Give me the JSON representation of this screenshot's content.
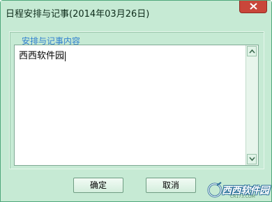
{
  "window": {
    "title": "日程安排与记事(2014年03月26日)"
  },
  "group": {
    "label": "安排与记事内容"
  },
  "memo": {
    "text": "西西软件园"
  },
  "buttons": {
    "ok_label": "确定",
    "cancel_label": "取消"
  },
  "watermark": {
    "brand": "西西软件园",
    "url": "CR173.COM"
  },
  "colors": {
    "window_bg": "#c6ead4",
    "close_button": "#c9463a",
    "group_label": "#2f7fd0"
  }
}
